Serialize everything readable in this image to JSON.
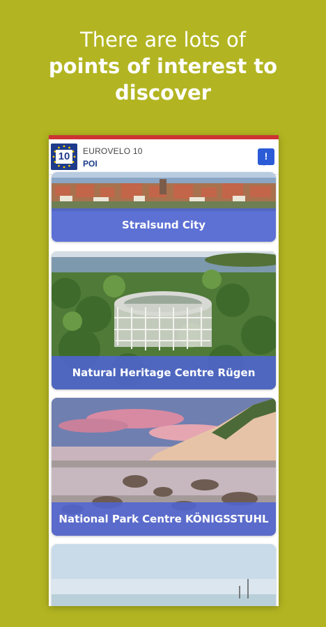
{
  "promo": {
    "line1": "There are lots of",
    "line2": "points of interest to",
    "line3": "discover"
  },
  "app": {
    "logo_number": "10",
    "title": "EUROVELO 10",
    "subtitle": "POI",
    "chat_icon": "chat-alert-icon",
    "accent_color": "#cc3333",
    "chat_color": "#2b5bd7"
  },
  "poi": [
    {
      "name": "Stralsund City"
    },
    {
      "name": "Natural Heritage Centre Rügen"
    },
    {
      "name": "National Park Centre KÖNIGSSTUHL"
    }
  ],
  "colors": {
    "background": "#b2b521",
    "caption_band": "#5064d2"
  }
}
